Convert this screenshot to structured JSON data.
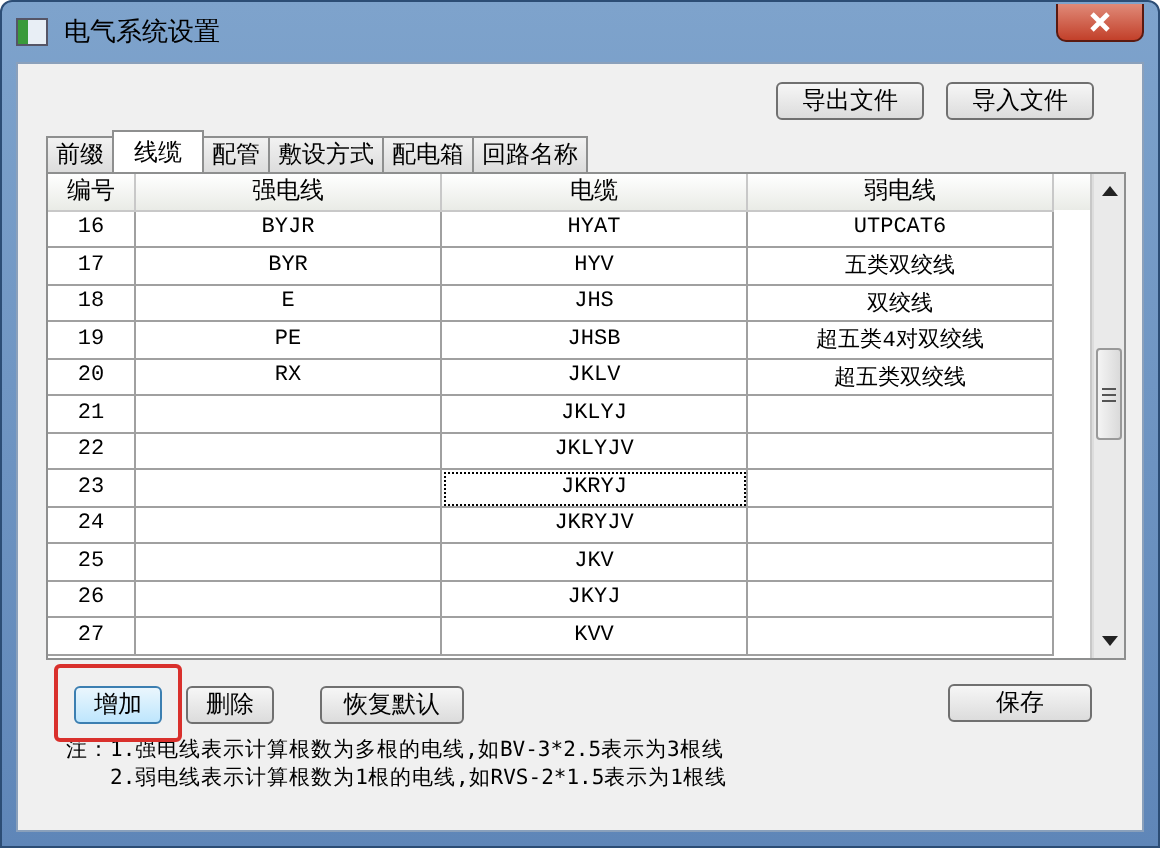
{
  "window": {
    "title": "电气系统设置"
  },
  "file_buttons": [
    "导出文件",
    "导入文件"
  ],
  "tabs": [
    {
      "label": "前缀",
      "selected": false
    },
    {
      "label": "线缆",
      "selected": true
    },
    {
      "label": "配管",
      "selected": false
    },
    {
      "label": "敷设方式",
      "selected": false
    },
    {
      "label": "配电箱",
      "selected": false
    },
    {
      "label": "回路名称",
      "selected": false
    }
  ],
  "table": {
    "columns": [
      "编号",
      "强电线",
      "电缆",
      "弱电线"
    ],
    "rows": [
      {
        "cells": [
          {
            "text": "16",
            "focused": false
          },
          {
            "text": "BYJR",
            "focused": false
          },
          {
            "text": "HYAT",
            "focused": false
          },
          {
            "text": "UTPCAT6",
            "focused": false
          }
        ]
      },
      {
        "cells": [
          {
            "text": "17",
            "focused": false
          },
          {
            "text": "BYR",
            "focused": false
          },
          {
            "text": "HYV",
            "focused": false
          },
          {
            "text": "五类双绞线",
            "focused": false
          }
        ]
      },
      {
        "cells": [
          {
            "text": "18",
            "focused": false
          },
          {
            "text": "E",
            "focused": false
          },
          {
            "text": "JHS",
            "focused": false
          },
          {
            "text": "双绞线",
            "focused": false
          }
        ]
      },
      {
        "cells": [
          {
            "text": "19",
            "focused": false
          },
          {
            "text": "PE",
            "focused": false
          },
          {
            "text": "JHSB",
            "focused": false
          },
          {
            "text": "超五类4对双绞线",
            "focused": false
          }
        ]
      },
      {
        "cells": [
          {
            "text": "20",
            "focused": false
          },
          {
            "text": "RX",
            "focused": false
          },
          {
            "text": "JKLV",
            "focused": false
          },
          {
            "text": "超五类双绞线",
            "focused": false
          }
        ]
      },
      {
        "cells": [
          {
            "text": "21",
            "focused": false
          },
          {
            "text": "",
            "focused": false
          },
          {
            "text": "JKLYJ",
            "focused": false
          },
          {
            "text": "",
            "focused": false
          }
        ]
      },
      {
        "cells": [
          {
            "text": "22",
            "focused": false
          },
          {
            "text": "",
            "focused": false
          },
          {
            "text": "JKLYJV",
            "focused": false
          },
          {
            "text": "",
            "focused": false
          }
        ]
      },
      {
        "cells": [
          {
            "text": "23",
            "focused": false
          },
          {
            "text": "",
            "focused": false
          },
          {
            "text": "JKRYJ",
            "focused": true
          },
          {
            "text": "",
            "focused": false
          }
        ]
      },
      {
        "cells": [
          {
            "text": "24",
            "focused": false
          },
          {
            "text": "",
            "focused": false
          },
          {
            "text": "JKRYJV",
            "focused": false
          },
          {
            "text": "",
            "focused": false
          }
        ]
      },
      {
        "cells": [
          {
            "text": "25",
            "focused": false
          },
          {
            "text": "",
            "focused": false
          },
          {
            "text": "JKV",
            "focused": false
          },
          {
            "text": "",
            "focused": false
          }
        ]
      },
      {
        "cells": [
          {
            "text": "26",
            "focused": false
          },
          {
            "text": "",
            "focused": false
          },
          {
            "text": "JKYJ",
            "focused": false
          },
          {
            "text": "",
            "focused": false
          }
        ]
      },
      {
        "cells": [
          {
            "text": "27",
            "focused": false
          },
          {
            "text": "",
            "focused": false
          },
          {
            "text": "KVV",
            "focused": false
          },
          {
            "text": "",
            "focused": false
          }
        ]
      }
    ]
  },
  "actions": [
    {
      "label": "增加",
      "highlighted": true
    },
    {
      "label": "删除",
      "highlighted": false
    },
    {
      "label": "恢复默认",
      "highlighted": false
    }
  ],
  "save_button": "保存",
  "notes": [
    "注：1.强电线表示计算根数为多根的电线,如BV-3*2.5表示为3根线",
    "2.弱电线表示计算根数为1根的电线,如RVS-2*1.5表示为1根线"
  ]
}
